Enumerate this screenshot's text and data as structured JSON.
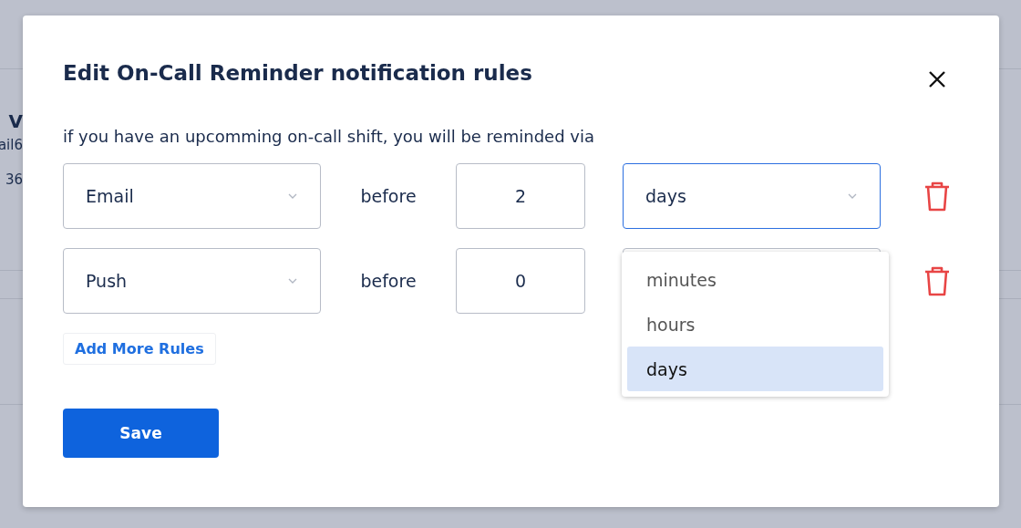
{
  "background": {
    "texts": [
      {
        "kind": "name",
        "text": "V"
      },
      {
        "kind": "detail",
        "text": "ail6"
      },
      {
        "kind": "detail",
        "text": "36"
      }
    ]
  },
  "dialog": {
    "title": "Edit On-Call Reminder notification rules",
    "subtitle": "if you have an upcomming on-call shift, you will be reminded via",
    "rules": [
      {
        "channel": "Email",
        "connector": "before",
        "amount": "2",
        "unit": "days",
        "focused": true
      },
      {
        "channel": "Push",
        "connector": "before",
        "amount": "0"
      }
    ],
    "unit_menu": {
      "options": [
        {
          "label": "minutes",
          "selected": false
        },
        {
          "label": "hours",
          "selected": false
        },
        {
          "label": "days",
          "selected": true
        }
      ]
    },
    "add_button": "Add More Rules",
    "save_button": "Save"
  }
}
